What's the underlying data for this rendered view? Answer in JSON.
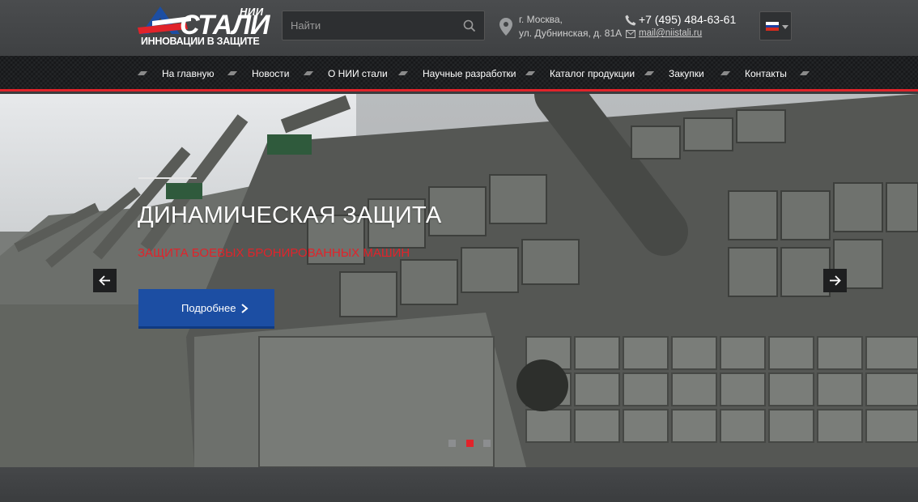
{
  "brand": {
    "logo_nii": "НИИ",
    "logo_name": "СТАЛИ",
    "logo_tagline": "ИННОВАЦИИ В ЗАЩИТЕ",
    "colors": {
      "red": "#e1232a",
      "blue": "#1c4ea3"
    }
  },
  "search": {
    "placeholder": "Найти",
    "value": "",
    "icon": "search-icon"
  },
  "contacts": {
    "address_line1": "г. Москва,",
    "address_line2": "ул. Дубнинская, д. 81А",
    "phone": "+7 (495) 484-63-61",
    "email": "mail@niistali.ru"
  },
  "language": {
    "selected": "ru",
    "flag_colors": [
      "#ffffff",
      "#1c3fa3",
      "#d52b1e"
    ]
  },
  "nav": {
    "items": [
      {
        "label": "На главную"
      },
      {
        "label": "Новости"
      },
      {
        "label": "О НИИ стали"
      },
      {
        "label": "Научные разработки"
      },
      {
        "label": "Каталог продукции"
      },
      {
        "label": "Закупки"
      },
      {
        "label": "Контакты"
      }
    ]
  },
  "hero": {
    "title": "ДИНАМИЧЕСКАЯ ЗАЩИТА",
    "subtitle": "ЗАЩИТА БОЕВЫХ БРОНИРОВАННЫХ МАШИН",
    "button_label": "Подробнее",
    "slides_total": 3,
    "active_slide": 2
  }
}
